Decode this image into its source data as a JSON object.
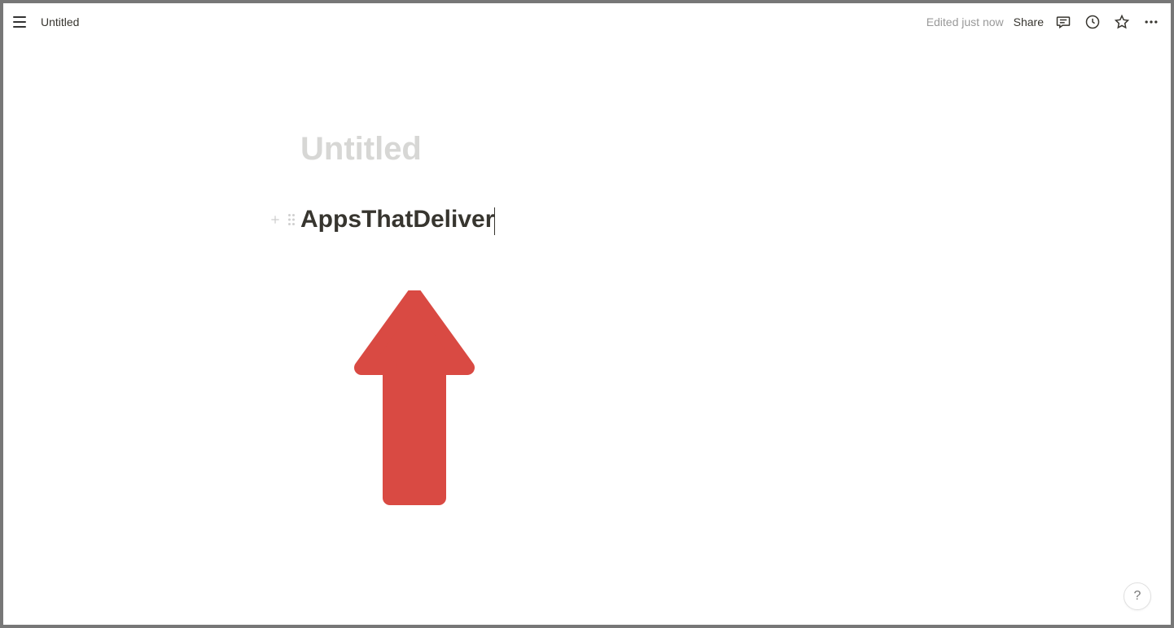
{
  "topbar": {
    "doc_title": "Untitled",
    "edited_label": "Edited just now",
    "share_label": "Share"
  },
  "page": {
    "title_placeholder": "Untitled",
    "heading_text": "AppsThatDeliver"
  },
  "help": {
    "label": "?"
  },
  "annotation": {
    "arrow_color": "#d94a43"
  }
}
